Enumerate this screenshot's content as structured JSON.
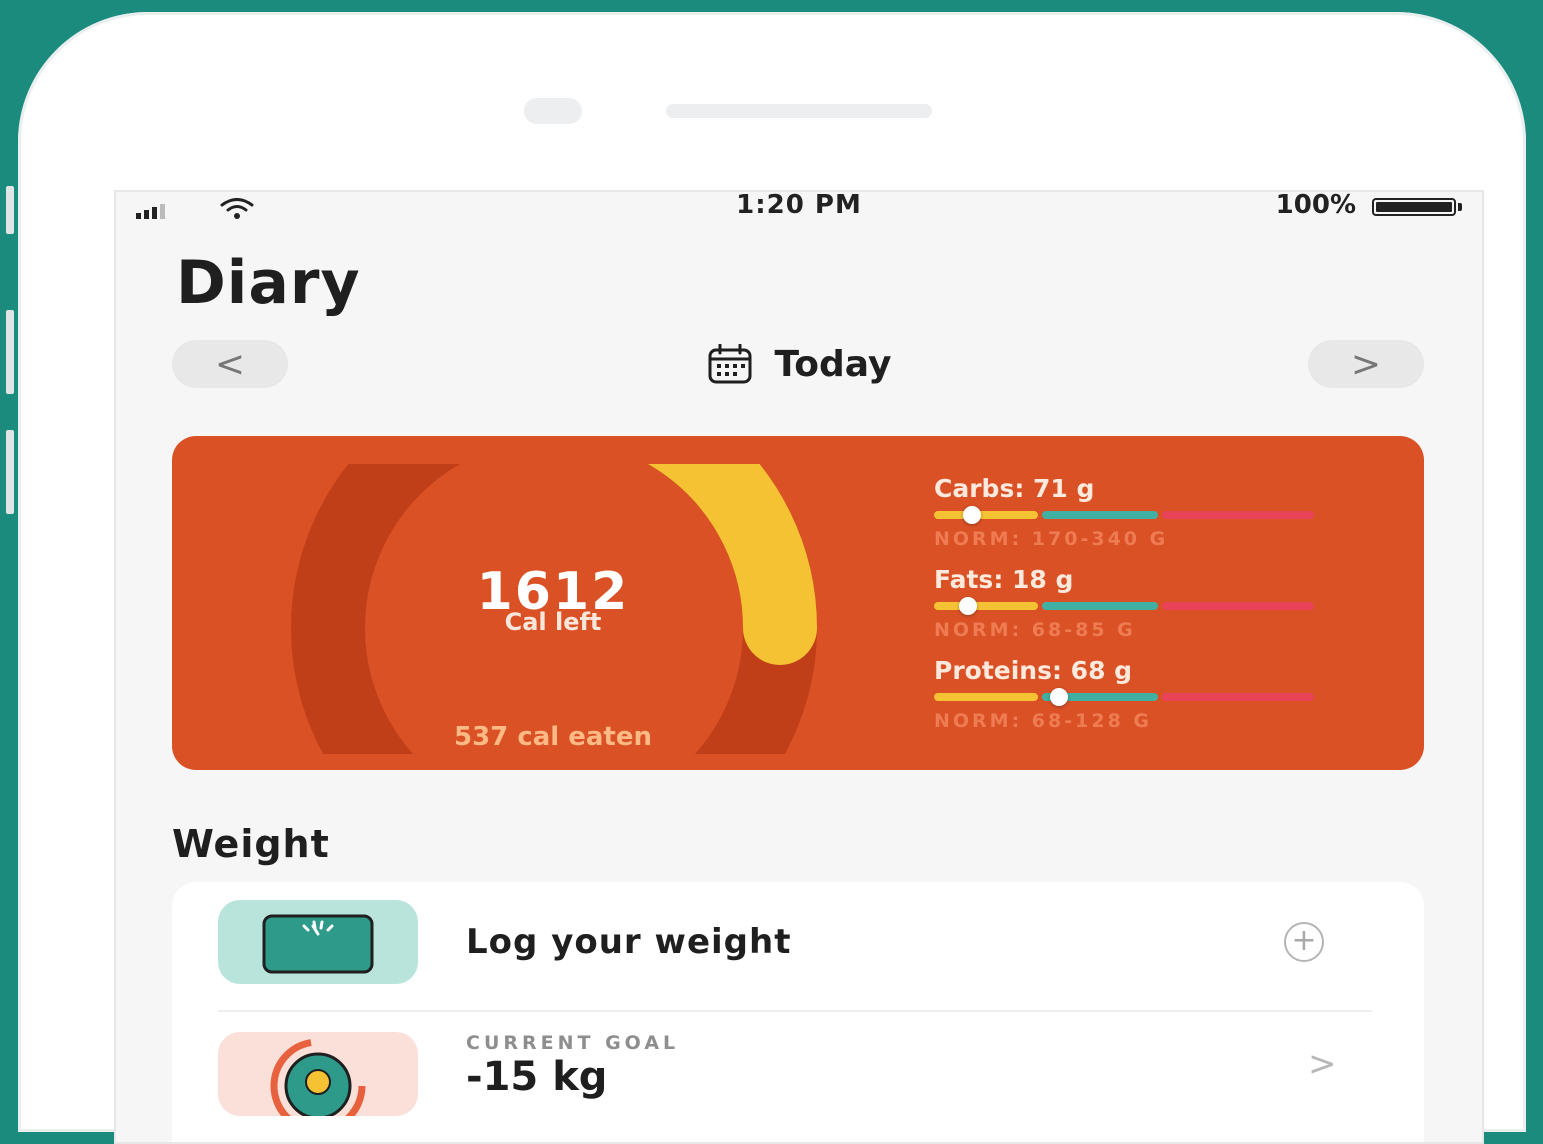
{
  "status_bar": {
    "time": "1:20 PM",
    "battery": "100%",
    "signal_icon": "signal-icon",
    "wifi_icon": "wifi-icon",
    "battery_icon": "battery-icon"
  },
  "header": {
    "title": "Diary"
  },
  "date_nav": {
    "prev_label": "<",
    "next_label": ">",
    "current": "Today",
    "icon": "calendar-icon"
  },
  "calories": {
    "left_value": "1612",
    "left_label": "Cal left",
    "eaten_label": "537 cal eaten",
    "eaten_fraction": 0.25,
    "icon": "flame-icon",
    "colors": {
      "card": "#d95125",
      "ring_track": "#c13f18",
      "ring_progress": "#f4c233",
      "flame_badge": "#f8d46a"
    }
  },
  "macros": [
    {
      "label": "Carbs: 71 g",
      "norm": "NORM: 170-340 G",
      "position": 0.1
    },
    {
      "label": "Fats: 18 g",
      "norm": "NORM: 68-85 G",
      "position": 0.09
    },
    {
      "label": "Proteins: 68 g",
      "norm": "NORM: 68-128 G",
      "position": 0.33
    }
  ],
  "weight": {
    "section_title": "Weight",
    "log_label": "Log your weight",
    "log_icon": "scale-icon",
    "add_label": "+",
    "goal_caption": "CURRENT GOAL",
    "goal_value": "-15 kg",
    "goal_icon": "goal-icon",
    "goal_chevron": ">"
  },
  "colors": {
    "background": "#1a8b7d",
    "screen": "#f6f6f6",
    "macro_low": "#f4c233",
    "macro_norm": "#3fb0a1",
    "macro_high": "#e9435a"
  }
}
